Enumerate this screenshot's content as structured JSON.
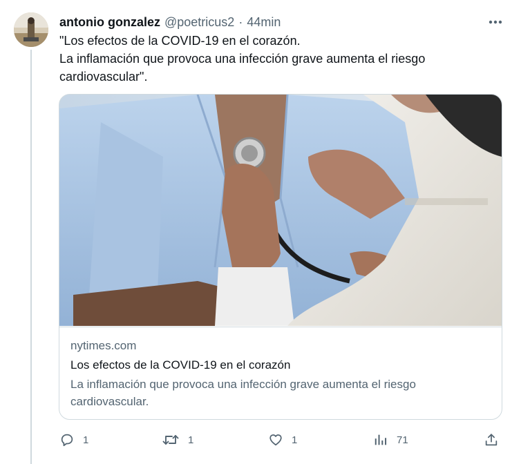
{
  "tweet": {
    "author_name": "antonio gonzalez",
    "author_handle": "@poetricus2",
    "separator": "·",
    "time": "44min",
    "text_lines": [
      "\"Los efectos de la COVID-19 en el corazón.",
      "La inflamación que provoca una infección grave aumenta el riesgo",
      "cardiovascular\"."
    ]
  },
  "card": {
    "domain": "nytimes.com",
    "title": "Los efectos de la COVID-19 en el corazón",
    "description_lines": [
      "La inflamación que provoca una infección grave aumenta el riesgo",
      "cardiovascular."
    ]
  },
  "actions": {
    "reply_count": "1",
    "retweet_count": "1",
    "like_count": "1",
    "views_count": "71"
  },
  "icons": {
    "more": "more-horizontal-icon",
    "reply": "reply-icon",
    "retweet": "retweet-icon",
    "like": "heart-icon",
    "views": "analytics-icon",
    "share": "share-icon"
  },
  "colors": {
    "text_primary": "#0f1419",
    "text_secondary": "#536471",
    "border": "#cfd9de"
  }
}
